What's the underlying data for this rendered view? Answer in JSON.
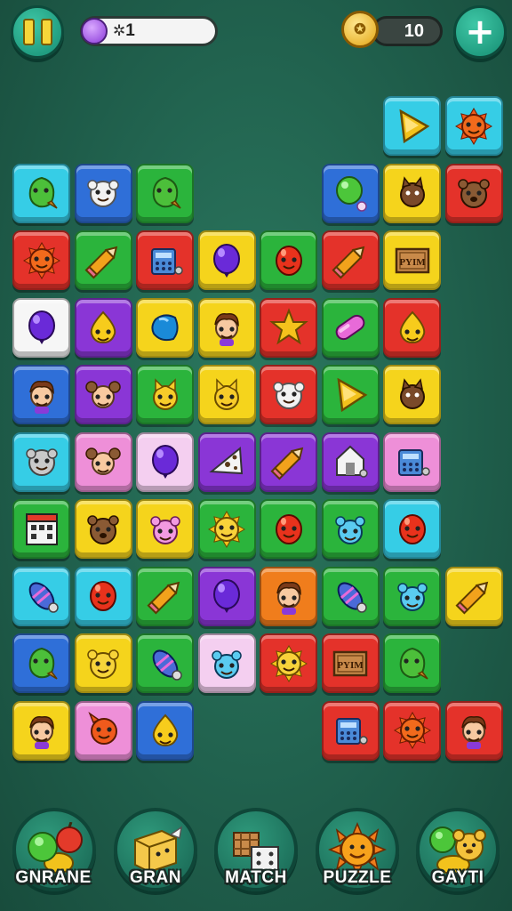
{
  "hud": {
    "level_label": "1",
    "coin_count": "10",
    "pause_icon": "pause-icon",
    "add_icon": "plus-icon"
  },
  "categories": [
    {
      "label": "GNRANE",
      "icon": "fruit-icon"
    },
    {
      "label": "GRAN",
      "icon": "block-character-icon"
    },
    {
      "label": "MATCH",
      "icon": "crates-icon"
    },
    {
      "label": "PUZZLE",
      "icon": "sun-icon"
    },
    {
      "label": "GAYTI",
      "icon": "bear-icon"
    }
  ],
  "tiles": [
    {
      "row": 0,
      "col": 6,
      "color": "cyan",
      "icon": "triangle"
    },
    {
      "row": 0,
      "col": 7,
      "color": "cyan",
      "icon": "sun"
    },
    {
      "row": 1,
      "col": 0,
      "color": "cyan",
      "icon": "leaf-creature"
    },
    {
      "row": 1,
      "col": 1,
      "color": "blue",
      "icon": "fluffy"
    },
    {
      "row": 1,
      "col": 2,
      "color": "green",
      "icon": "leaf-creature"
    },
    {
      "row": 1,
      "col": 5,
      "color": "blue",
      "icon": "green-balloon"
    },
    {
      "row": 1,
      "col": 6,
      "color": "yellow",
      "icon": "brown-cat"
    },
    {
      "row": 1,
      "col": 7,
      "color": "red",
      "icon": "brown-bear"
    },
    {
      "row": 2,
      "col": 0,
      "color": "red",
      "icon": "sun"
    },
    {
      "row": 2,
      "col": 1,
      "color": "green",
      "icon": "pencil"
    },
    {
      "row": 2,
      "col": 2,
      "color": "red",
      "icon": "machine"
    },
    {
      "row": 2,
      "col": 3,
      "color": "yellow",
      "icon": "purple-balloon"
    },
    {
      "row": 2,
      "col": 4,
      "color": "green",
      "icon": "red-face"
    },
    {
      "row": 2,
      "col": 5,
      "color": "red",
      "icon": "pencil"
    },
    {
      "row": 2,
      "col": 6,
      "color": "yellow",
      "icon": "crate",
      "text": "PYIM"
    },
    {
      "row": 3,
      "col": 0,
      "color": "white",
      "icon": "purple-balloon"
    },
    {
      "row": 3,
      "col": 1,
      "color": "purple",
      "icon": "yellow-drop"
    },
    {
      "row": 3,
      "col": 2,
      "color": "yellow",
      "icon": "blue-gem"
    },
    {
      "row": 3,
      "col": 3,
      "color": "yellow",
      "icon": "boy"
    },
    {
      "row": 3,
      "col": 4,
      "color": "red",
      "icon": "star"
    },
    {
      "row": 3,
      "col": 5,
      "color": "green",
      "icon": "pink-pill"
    },
    {
      "row": 3,
      "col": 6,
      "color": "red",
      "icon": "yellow-drop"
    },
    {
      "row": 4,
      "col": 0,
      "color": "blue",
      "icon": "boy"
    },
    {
      "row": 4,
      "col": 1,
      "color": "purple",
      "icon": "mouse"
    },
    {
      "row": 4,
      "col": 2,
      "color": "green",
      "icon": "yellow-cat"
    },
    {
      "row": 4,
      "col": 3,
      "color": "yellow",
      "icon": "yellow-cat"
    },
    {
      "row": 4,
      "col": 4,
      "color": "red",
      "icon": "fluffy"
    },
    {
      "row": 4,
      "col": 5,
      "color": "green",
      "icon": "triangle"
    },
    {
      "row": 4,
      "col": 6,
      "color": "yellow",
      "icon": "brown-cat"
    },
    {
      "row": 5,
      "col": 0,
      "color": "cyan",
      "icon": "fluffy-gray"
    },
    {
      "row": 5,
      "col": 1,
      "color": "pink",
      "icon": "mouse"
    },
    {
      "row": 5,
      "col": 2,
      "color": "lpink",
      "icon": "purple-balloon"
    },
    {
      "row": 5,
      "col": 3,
      "color": "purple",
      "icon": "cheese"
    },
    {
      "row": 5,
      "col": 4,
      "color": "purple",
      "icon": "pencil"
    },
    {
      "row": 5,
      "col": 5,
      "color": "purple",
      "icon": "house"
    },
    {
      "row": 5,
      "col": 6,
      "color": "pink",
      "icon": "machine"
    },
    {
      "row": 6,
      "col": 0,
      "color": "green",
      "icon": "building"
    },
    {
      "row": 6,
      "col": 1,
      "color": "yellow",
      "icon": "brown-bear"
    },
    {
      "row": 6,
      "col": 2,
      "color": "yellow",
      "icon": "pink-creature"
    },
    {
      "row": 6,
      "col": 3,
      "color": "green",
      "icon": "sun-yellow"
    },
    {
      "row": 6,
      "col": 4,
      "color": "green",
      "icon": "red-face"
    },
    {
      "row": 6,
      "col": 5,
      "color": "green",
      "icon": "blue-creature"
    },
    {
      "row": 6,
      "col": 6,
      "color": "cyan",
      "icon": "red-face"
    },
    {
      "row": 7,
      "col": 0,
      "color": "cyan",
      "icon": "egg-rocket"
    },
    {
      "row": 7,
      "col": 1,
      "color": "cyan",
      "icon": "red-face"
    },
    {
      "row": 7,
      "col": 2,
      "color": "green",
      "icon": "pencil"
    },
    {
      "row": 7,
      "col": 3,
      "color": "purple",
      "icon": "purple-balloon"
    },
    {
      "row": 7,
      "col": 4,
      "color": "orange",
      "icon": "boy"
    },
    {
      "row": 7,
      "col": 5,
      "color": "green",
      "icon": "egg-rocket"
    },
    {
      "row": 7,
      "col": 6,
      "color": "green",
      "icon": "blue-creature"
    },
    {
      "row": 7,
      "col": 7,
      "color": "yellow",
      "icon": "pencil"
    },
    {
      "row": 8,
      "col": 0,
      "color": "blue",
      "icon": "leaf-creature"
    },
    {
      "row": 8,
      "col": 1,
      "color": "yellow",
      "icon": "yellow-bear"
    },
    {
      "row": 8,
      "col": 2,
      "color": "green",
      "icon": "egg-rocket"
    },
    {
      "row": 8,
      "col": 3,
      "color": "lpink",
      "icon": "blue-creature"
    },
    {
      "row": 8,
      "col": 4,
      "color": "red",
      "icon": "sun-yellow"
    },
    {
      "row": 8,
      "col": 5,
      "color": "red",
      "icon": "crate",
      "text": "PYIM"
    },
    {
      "row": 8,
      "col": 6,
      "color": "green",
      "icon": "leaf-creature"
    },
    {
      "row": 9,
      "col": 0,
      "color": "yellow",
      "icon": "boy"
    },
    {
      "row": 9,
      "col": 1,
      "color": "pink",
      "icon": "red-creature"
    },
    {
      "row": 9,
      "col": 2,
      "color": "blue",
      "icon": "yellow-drop"
    },
    {
      "row": 9,
      "col": 5,
      "color": "red",
      "icon": "machine"
    },
    {
      "row": 9,
      "col": 6,
      "color": "red",
      "icon": "sun"
    },
    {
      "row": 9,
      "col": 7,
      "color": "red",
      "icon": "boy"
    }
  ]
}
